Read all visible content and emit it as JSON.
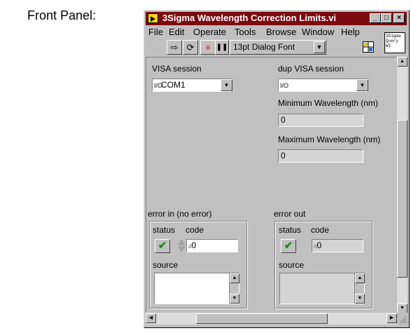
{
  "caption": "Front Panel:",
  "window": {
    "title": "3Sigma Wavelength Correction Limits.vi",
    "minimize": "_",
    "maximize": "□",
    "close": "×"
  },
  "menubar": {
    "items": [
      "File",
      "Edit",
      "Operate",
      "Tools",
      "Browse",
      "Window",
      "Help"
    ]
  },
  "toolbar": {
    "run": "⇨",
    "run_continuous": "⟳",
    "abort": "●",
    "pause": "❚❚",
    "font": "13pt Dialog Font",
    "font_arrow": "▼"
  },
  "icon_pane": {
    "text": "3Sigma Query WI"
  },
  "panel": {
    "visa_session": {
      "label": "VISA session",
      "tag": "I/O",
      "value": "COM1"
    },
    "dup_visa_session": {
      "label": "dup VISA session",
      "tag": "I/O",
      "value": ""
    },
    "min_wavelength": {
      "label": "Minimum Wavelength (nm)",
      "value": "0"
    },
    "max_wavelength": {
      "label": "Maximum Wavelength (nm)",
      "value": "0"
    },
    "error_in": {
      "label": "error in (no error)",
      "status_label": "status",
      "code_label": "code",
      "code_value": "0",
      "source_label": "source",
      "check": "✔"
    },
    "error_out": {
      "label": "error out",
      "status_label": "status",
      "code_label": "code",
      "code_value": "0",
      "source_label": "source",
      "check": "✔"
    }
  }
}
